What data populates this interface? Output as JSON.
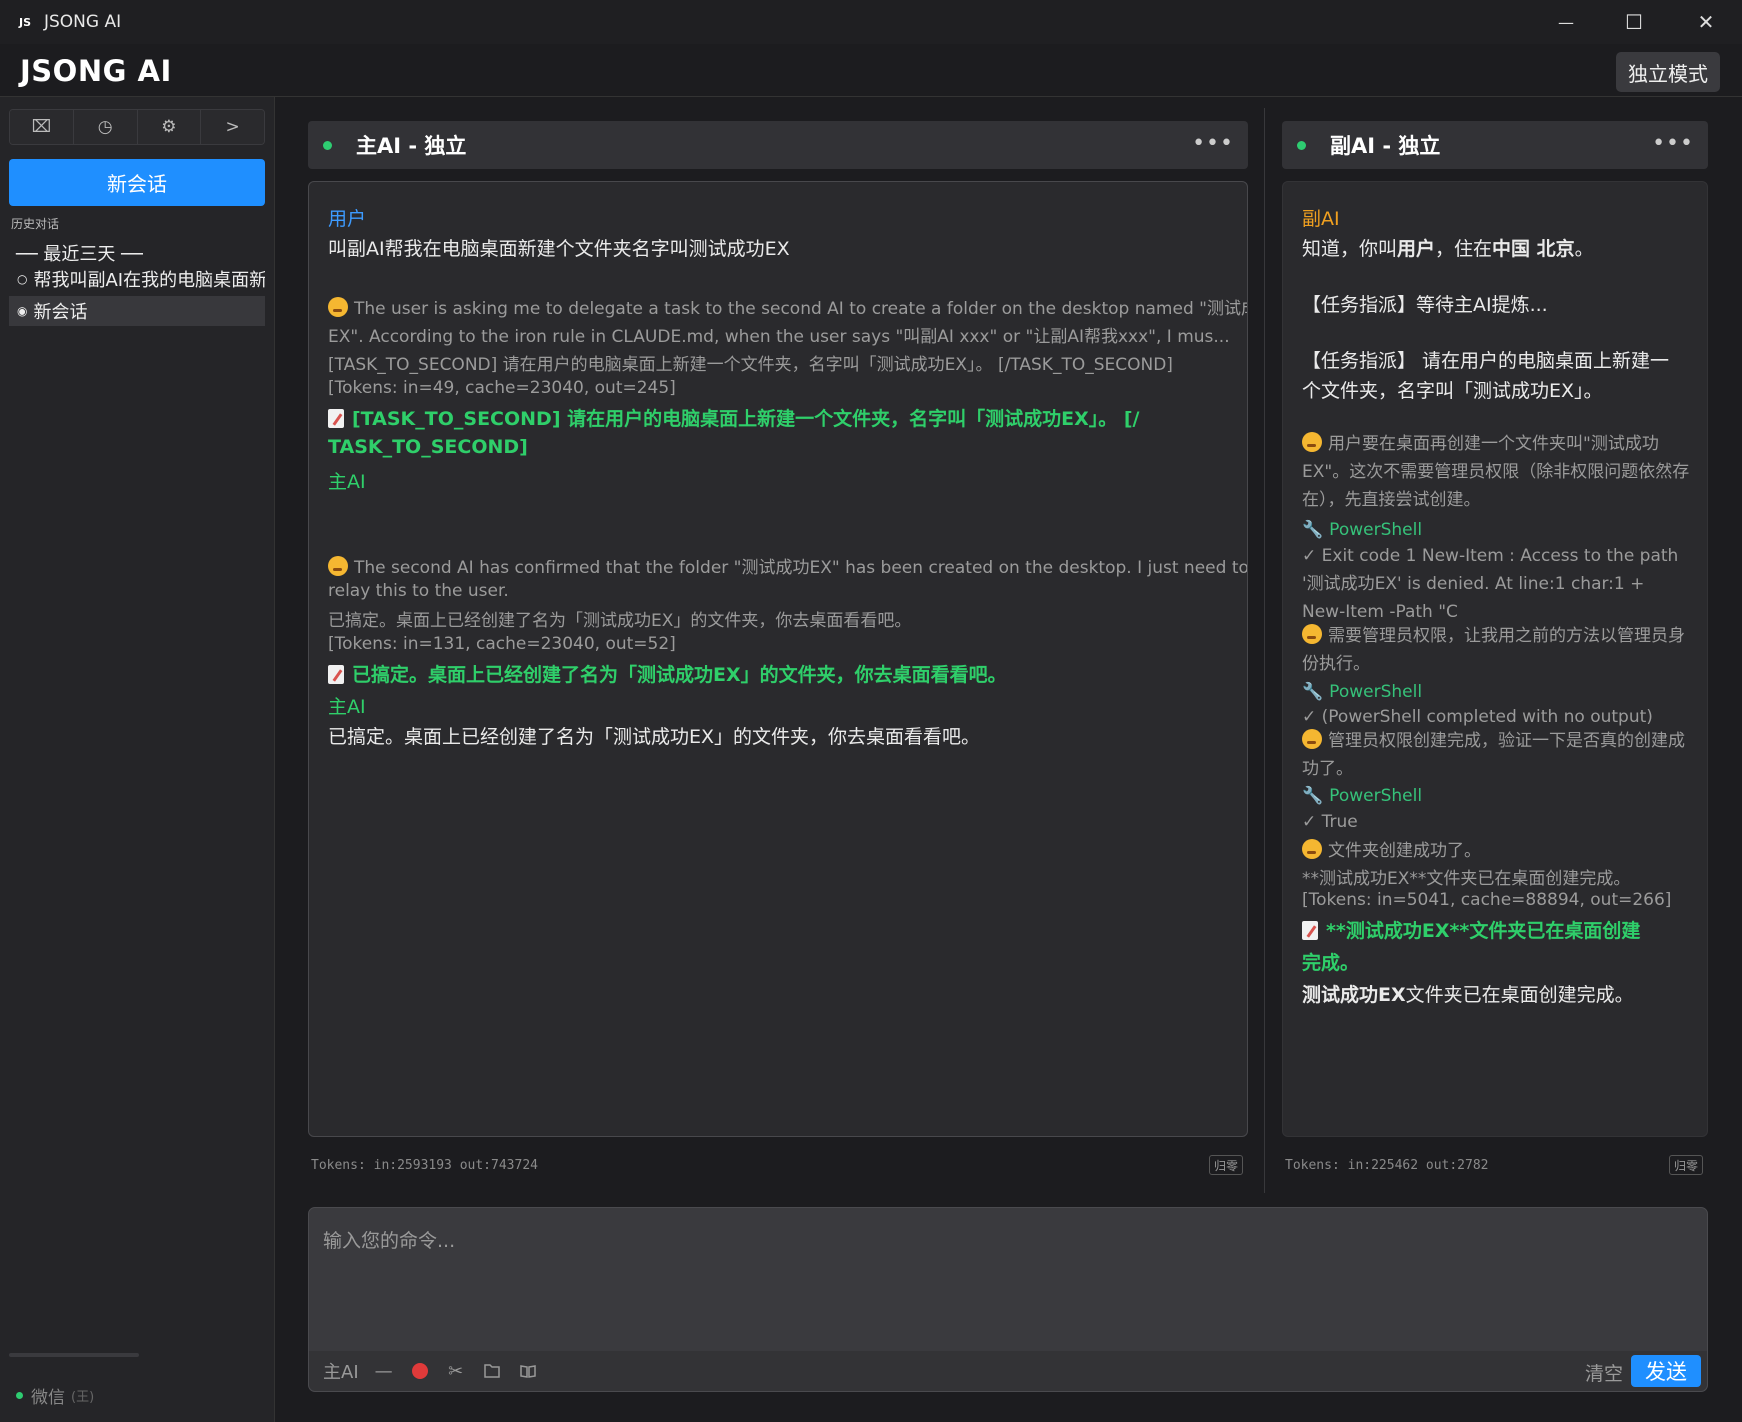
{
  "window": {
    "title": "JSONG AI",
    "logo": "JS",
    "controls": {
      "minimize": "—",
      "maximize": "☐",
      "close": "✕"
    }
  },
  "header": {
    "brand": "JSONG AI",
    "mode_button": "独立模式"
  },
  "sidebar": {
    "tools": [
      {
        "icon": "book-icon",
        "glyph": "⌧"
      },
      {
        "icon": "history-icon",
        "glyph": "◷"
      },
      {
        "icon": "gear-icon",
        "glyph": "⚙"
      },
      {
        "icon": "chevron-right-icon",
        "glyph": ">"
      }
    ],
    "new_chat": "新会话",
    "history_label": "历史对话",
    "group_label": "── 最近三天 ──",
    "items": [
      {
        "label": "帮我叫副AI在我的电脑桌面新",
        "dot": "○"
      },
      {
        "label": "新会话",
        "dot": "◉"
      }
    ],
    "wechat": "微信",
    "wechat_tag": "(王)"
  },
  "main_panel": {
    "title": "主AI - 独立",
    "more": "•••",
    "messages": {
      "user_role": "用户",
      "user_text": "叫副AI帮我在电脑桌面新建个文件夹名字叫测试成功EX",
      "think1_l1": "The user is asking me to delegate a task to the second AI to create a folder on the desktop named \"测试成功",
      "think1_l2": "EX\". According to the iron rule in CLAUDE.md, when the user says \"叫副AI xxx\" or \"让副AI帮我xxx\", I mus...",
      "think1_l3": "[TASK_TO_SECOND] 请在用户的电脑桌面上新建一个文件夹，名字叫「测试成功EX」。 [/TASK_TO_SECOND]",
      "tokens1": "[Tokens: in=49, cache=23040, out=245]",
      "out1_l1": "[TASK_TO_SECOND] 请在用户的电脑桌面上新建一个文件夹，名字叫「测试成功EX」。 [/",
      "out1_l2": "TASK_TO_SECOND]",
      "ai_role1": "主AI",
      "think2_l1": "The second AI has confirmed that the folder \"测试成功EX\" has been created on the desktop. I just need to",
      "think2_l2": "relay this to the user.",
      "think2_l3": "已搞定。桌面上已经创建了名为「测试成功EX」的文件夹，你去桌面看看吧。",
      "tokens2": "[Tokens: in=131, cache=23040, out=52]",
      "out2": "已搞定。桌面上已经创建了名为「测试成功EX」的文件夹，你去桌面看看吧。",
      "ai_role2": "主AI",
      "final": "已搞定。桌面上已经创建了名为「测试成功EX」的文件夹，你去桌面看看吧。"
    },
    "tokens_footer": "Tokens: in:2593193  out:743724",
    "reset": "归零"
  },
  "sub_panel": {
    "title": "副AI - 独立",
    "more": "•••",
    "messages": {
      "role": "副AI",
      "l1_pre": "知道，你叫",
      "l1_b1": "用户",
      "l1_mid": "，住在",
      "l1_b2": "中国 北京",
      "l1_end": "。",
      "l2": "【任务指派】等待主AI提炼...",
      "l3": "【任务指派】 请在用户的电脑桌面上新建一",
      "l4": "个文件夹，名字叫「测试成功EX」。",
      "t1": "用户要在桌面再创建一个文件夹叫\"测试成功EX\"。这次不需要管理员权限（除非权限问题依然存在），先直接尝试创建。",
      "tool1": "PowerShell",
      "r1": "✓ Exit code 1 New-Item : Access to the path '测试成功EX' is denied. At line:1 char:1 + New-Item -Path \"C",
      "t2": "需要管理员权限，让我用之前的方法以管理员身份执行。",
      "tool2": "PowerShell",
      "r2": "✓ (PowerShell completed with no output)",
      "t3": "管理员权限创建完成，验证一下是否真的创建成功了。",
      "tool3": "PowerShell",
      "r3": "✓ True",
      "t4": "文件夹创建成功了。",
      "t5": "**测试成功EX**文件夹已在桌面创建完成。",
      "tokens": "[Tokens: in=5041, cache=88894, out=266]",
      "out_l1": "**测试成功EX**文件夹已在桌面创建",
      "out_l2": "完成。",
      "final_b": "测试成功EX",
      "final_rest": "文件夹已在桌面创建完成。"
    },
    "tokens_footer": "Tokens: in:225462  out:2782",
    "reset": "归零"
  },
  "input": {
    "placeholder": "输入您的命令...",
    "target": "主AI",
    "minus": "—",
    "scissors": "✂",
    "clear": "清空",
    "send": "发送"
  },
  "colors": {
    "accent": "#1f8fff",
    "green": "#2fcf6a",
    "orange": "#f0a020",
    "user_blue": "#3d9bff"
  }
}
